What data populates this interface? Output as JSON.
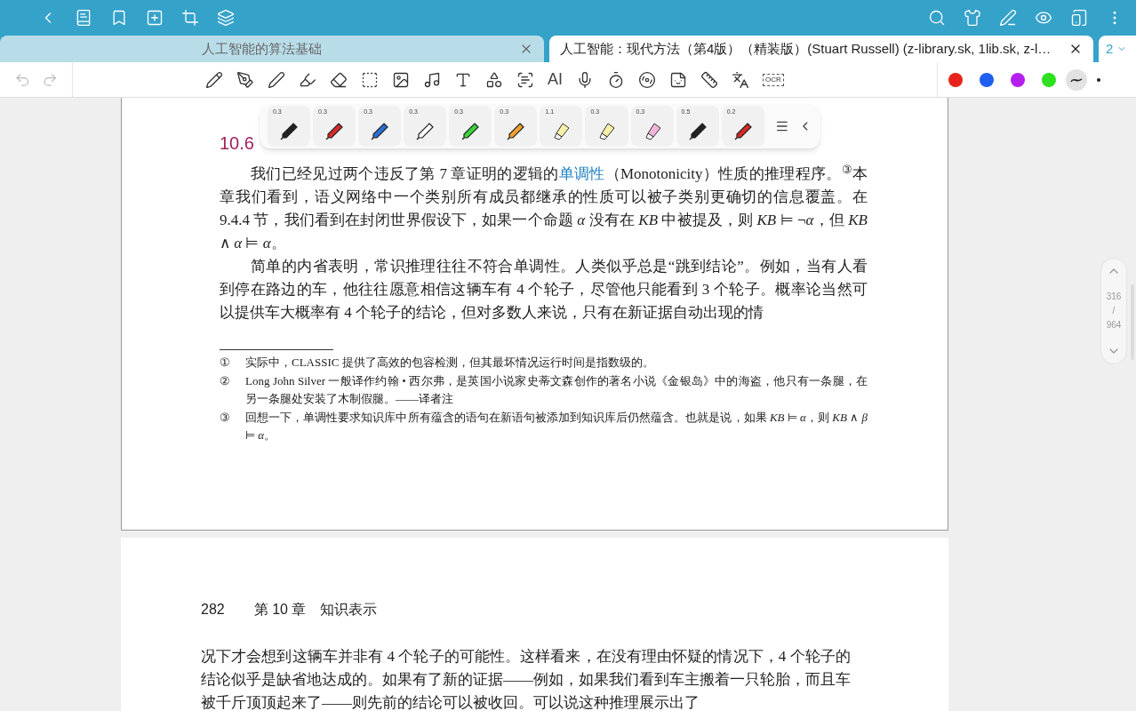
{
  "tabs": [
    {
      "title": "人工智能的算法基础",
      "selected": false
    },
    {
      "title": "人工智能：现代方法（第4版）（精装版）(Stuart Russell) (z-library.sk, 1lib.sk, z-l…",
      "selected": true
    }
  ],
  "tab_count": "2",
  "tool_labels": [
    "AI",
    "OCR"
  ],
  "palette": [
    {
      "color": "#e8231b",
      "selected": false
    },
    {
      "color": "#1f5ff0",
      "selected": false
    },
    {
      "color": "#b41ff0",
      "selected": false
    },
    {
      "color": "#2ee01f",
      "selected": false
    }
  ],
  "stroke_style": {
    "selected": true
  },
  "pens": [
    {
      "kind": "pen",
      "size": "0.3",
      "color": "#222222"
    },
    {
      "kind": "pen",
      "size": "0.3",
      "color": "#d42a2a"
    },
    {
      "kind": "pen",
      "size": "0.3",
      "color": "#2a6fd4"
    },
    {
      "kind": "pen",
      "size": "0.3",
      "color": "#ffffff"
    },
    {
      "kind": "pen",
      "size": "0.3",
      "color": "#3ad43a"
    },
    {
      "kind": "pen",
      "size": "0.3",
      "color": "#f0a030"
    },
    {
      "kind": "highlighter",
      "size": "1.1",
      "color": "#f5f0a8"
    },
    {
      "kind": "highlighter",
      "size": "0.3",
      "color": "#f5f0a8"
    },
    {
      "kind": "highlighter",
      "size": "0.3",
      "color": "#f2b4d8"
    },
    {
      "kind": "pen",
      "size": "0.5",
      "color": "#222222"
    },
    {
      "kind": "pen",
      "size": "0.2",
      "color": "#d42a2a"
    }
  ],
  "page_1": {
    "heading": "10.6",
    "paragraphs": [
      [
        {
          "kind": "text",
          "text": "我们已经见过两个违反了第 7 章证明的逻辑的"
        },
        {
          "kind": "term",
          "text": "单调性"
        },
        {
          "kind": "text",
          "text": "（Monotonicity）性质的推理程序。$^{③}$本章我们看到，语义网络中一个类别所有成员都继承的性质可以被子类别更确切的信息覆盖。在 9.4.4 节，我们看到在封闭世界假设下，如果一个命题 *α* 没有在 *KB* 中被提及，则 *KB* ⊨ ¬*α*，但 *KB* ∧ *α* ⊨ *α*。"
        }
      ],
      [
        {
          "kind": "text",
          "text": "简单的内省表明，常识推理往往不符合单调性。人类似乎总是“跳到结论”。例如，当有人看到停在路边的车，他往往愿意相信这辆车有 4 个轮子，尽管他只能看到 3 个轮子。概率论当然可以提供车大概率有 4 个轮子的结论，但对多数人来说，只有在新证据自动出现的情"
        }
      ]
    ],
    "footnotes": [
      {
        "mark": "①",
        "text": "实际中，CLASSIC 提供了高效的包容检测，但其最坏情况运行时间是指数级的。"
      },
      {
        "mark": "②",
        "text": "Long John Silver 一般译作约翰 • 西尔弗，是英国小说家史蒂文森创作的著名小说《金银岛》中的海盗，他只有一条腿，在另一条腿处安装了木制假腿。——译者注"
      },
      {
        "mark": "③",
        "text": "回想一下，单调性要求知识库中所有蕴含的语句在新语句被添加到知识库后仍然蕴含。也就是说，如果 *KB* ⊨ *α*，则 *KB* ∧ *β* ⊨ *α*。"
      }
    ]
  },
  "page_indicator": {
    "current": "316",
    "separator": "/",
    "total": "964"
  },
  "page_2": {
    "page_number": "282",
    "running_head": "第 10 章　知识表示",
    "paragraph": "况下才会想到这辆车并非有 4 个轮子的可能性。这样看来，在没有理由怀疑的情况下，4 个轮子的结论似乎是缺省地达成的。如果有了新的证据——例如，如果我们看到车主搬着一只轮胎，而且车被千斤顶顶起来了——则先前的结论可以被收回。可以说这种推理展示出了"
  }
}
